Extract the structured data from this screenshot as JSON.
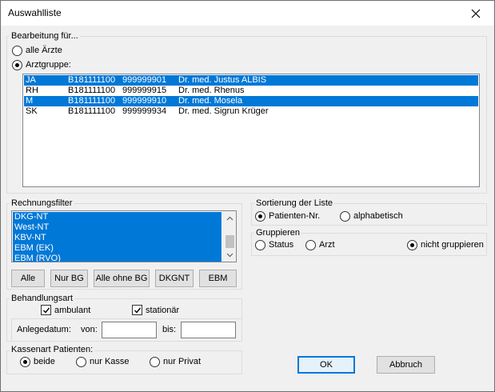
{
  "window": {
    "title": "Auswahlliste"
  },
  "bearbeitung": {
    "label": "Bearbeitung für...",
    "option_all": "alle Ärzte",
    "option_group": "Arztgruppe:",
    "selected": "group",
    "doctors": [
      {
        "code": "JA",
        "nr": "B181111100",
        "id": "999999901",
        "name": "Dr. med. Justus ALBIS",
        "selected": true
      },
      {
        "code": "RH",
        "nr": "B181111100",
        "id": "999999915",
        "name": "Dr. med. Rhenus",
        "selected": false
      },
      {
        "code": "M",
        "nr": "B181111100",
        "id": "999999910",
        "name": "Dr. med. Mosela",
        "selected": true
      },
      {
        "code": "SK",
        "nr": "B181111100",
        "id": "999999934",
        "name": "Dr. med. Sigrun Krüger",
        "selected": false
      }
    ]
  },
  "rechnungsfilter": {
    "label": "Rechnungsfilter",
    "items": [
      "DKG-NT",
      "West-NT",
      "KBV-NT",
      "EBM (EK)",
      "EBM (RVO)"
    ],
    "buttons": {
      "alle": "Alle",
      "nur_bg": "Nur BG",
      "alle_ohne_bg": "Alle ohne BG",
      "dkgnt": "DKGNT",
      "ebm": "EBM"
    }
  },
  "behandlungsart": {
    "label": "Behandlungsart",
    "ambulant": "ambulant",
    "stationaer": "stationär",
    "ambulant_checked": true,
    "stationaer_checked": true
  },
  "anlegedatum": {
    "label": "Anlegedatum:",
    "von_label": "von:",
    "bis_label": "bis:",
    "von_value": "",
    "bis_value": ""
  },
  "kassenart": {
    "label": "Kassenart Patienten:",
    "beide": "beide",
    "nur_kasse": "nur Kasse",
    "nur_privat": "nur Privat",
    "selected": "beide"
  },
  "sortierung": {
    "label": "Sortierung der Liste",
    "patienten_nr": "Patienten-Nr.",
    "alphabetisch": "alphabetisch",
    "selected": "patienten_nr"
  },
  "gruppieren": {
    "label": "Gruppieren",
    "status": "Status",
    "arzt": "Arzt",
    "nicht": "nicht gruppieren",
    "selected": "nicht"
  },
  "actions": {
    "ok": "OK",
    "abbruch": "Abbruch"
  },
  "colors": {
    "selection": "#0078d7",
    "dialog_bg": "#f0f0f0",
    "default_button_border": "#0078d7"
  }
}
